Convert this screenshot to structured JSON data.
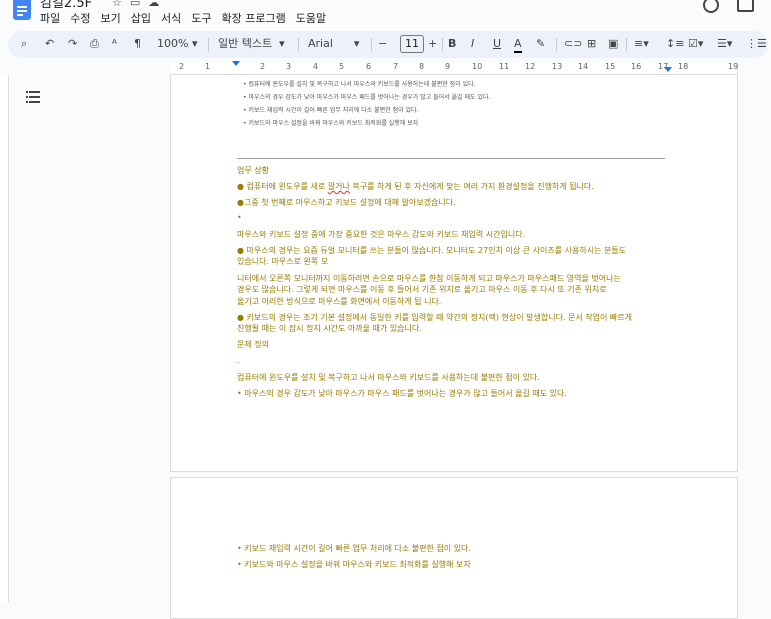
{
  "window": {
    "title": "김길2.5F",
    "title_partial": true
  },
  "menu": [
    "파일",
    "수정",
    "보기",
    "삽입",
    "서식",
    "도구",
    "확장 프로그램",
    "도움말"
  ],
  "toolbar": {
    "zoom": "100%",
    "style": "일반 텍스트",
    "font": "Arial",
    "font_size": "11",
    "minus": "−",
    "plus": "+",
    "bold": "B",
    "italic": "I",
    "underline": "U",
    "text_color": "A"
  },
  "ruler": {
    "numbers": [
      "2",
      "1",
      "1",
      "2",
      "3",
      "4",
      "5",
      "6",
      "7",
      "8",
      "9",
      "10",
      "11",
      "12",
      "13",
      "14",
      "15",
      "16",
      "17",
      "18",
      "19"
    ]
  },
  "page1": {
    "top_bullets": [
      "컴퓨터에 윈도우를 설치 및 복구하고 나서 마우스와 키보드를 사용하는데 불편한 점이 있다.",
      "마우스의 경우 감도가 낮아 마우스가 마우스 패드를 벗어나는 경우가 많고 들어서 옮길 때도 있다.",
      "키보드 재입력 시간이 길어 빠른 업무 처리에 다소 불편한 점이 있다.",
      "키보드와 마우스 설정을 바꿔 마우스와 키보드 최적화를 실행해 보자"
    ],
    "heading1": "업무 상황",
    "para1_a": "● 컴퓨터에 윈도우를 새로 ",
    "para1_err": "깔거나",
    "para1_b": " 복구를 하게 된 후 자신에게 맞는 여러 가지 환경설정을 진행하게 됩니다.",
    "para2": "●그중 첫 번째로 마우스하고 키보드 설정에 대해 알아보겠습니다.",
    "para3": "•",
    "para4": "마우스와 키보드 설정 중에 가장 중요한 것은 마우스 감도와 키보드 재입력 시간입니다.",
    "para5_l1": "● 마우스의 경우는 요즘 듀얼 모니터를 쓰는 분들이 많습니다. 모니터도 27인치 이상 큰 사이즈를 사용하시는 분들도",
    "para5_l2": "있습니다. 마우스로 왼쪽 모",
    "para6_l1": "니터에서 오른쪽 모니터까지 이동하려면 손으로 마우스를 한참 이동하게 되고 마우스가 마우스패드 영역을 벗어나는",
    "para6_l2": "경우도 많습니다. 그렇게 되면 마우스를 이동 후 들어서 기존 위치로 옮기고 마우스 이동 후 다시 또 기존 위치로",
    "para6_l3": "옮기고 이러한 방식으로 마우스를 화면에서 이동하게 됩 니다.",
    "para7_l1": "● 키보드의 경우는 조기 기본 설정에서 동일한 키를 입력할 때 약간의 정지(렉) 현상이 발생합니다. 문서 작업이 빠르게",
    "para7_l2": "진행될 때는 이 잠시 정지 시간도 아까울 때가 있습니다.",
    "heading2": "문제 정의",
    "para8": ".",
    "para9": "컴퓨터에 윈도우를 설치 및 복구하고 나서 마우스와 키보드를 사용하는데 불편한 점이 있다.",
    "para10": "• 마우스의 경우 감도가 낮아 마우스가 마우스 패드를 벗어나는 경우가 많고 들어서 옮길 때도 있다."
  },
  "page2": {
    "line1": "• 키보드 재입력 시간이 길어 빠른 업무 처리에 다소 불편한 점이 있다.",
    "line2": "• 키보드와 마우스 설정을 바꿔 마우스와 키보드 최적화를 실행해 보자"
  },
  "colors": {
    "accent": "#4285f4",
    "doc_text": "#9a7a00",
    "spell_error": "#d93025"
  }
}
